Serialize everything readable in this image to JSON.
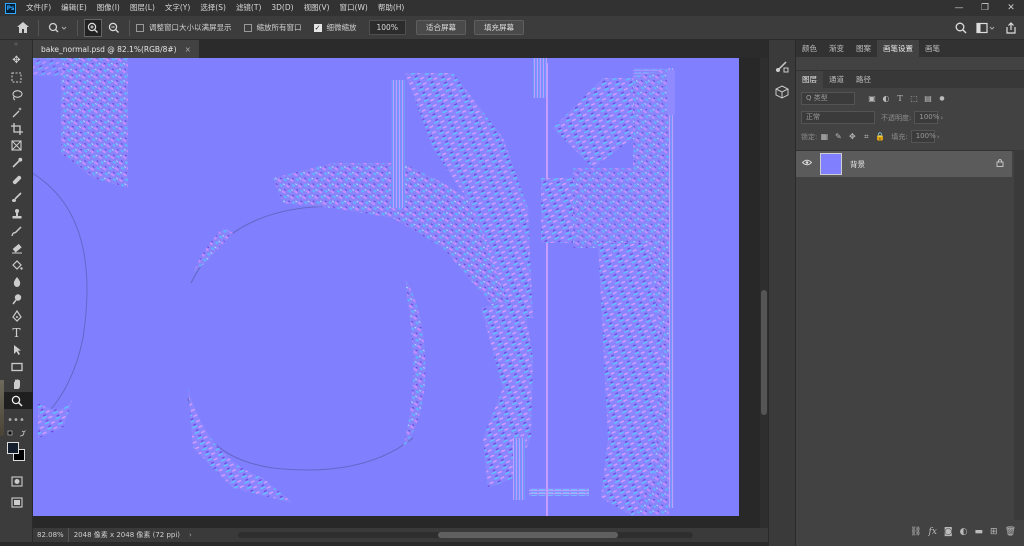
{
  "app": {
    "logo": "Ps"
  },
  "menu": [
    "文件(F)",
    "编辑(E)",
    "图像(I)",
    "图层(L)",
    "文字(Y)",
    "选择(S)",
    "滤镜(T)",
    "3D(D)",
    "视图(V)",
    "窗口(W)",
    "帮助(H)"
  ],
  "window": {
    "minimize": "—",
    "restore": "❐",
    "close": "✕"
  },
  "options": {
    "resize_windows": {
      "label": "调整窗口大小以满屏显示",
      "checked": false
    },
    "zoom_all": {
      "label": "缩放所有窗口",
      "checked": false
    },
    "scrubby_zoom": {
      "label": "细微缩放",
      "checked": true
    },
    "zoom_value": "100%",
    "fit_screen": "适合屏幕",
    "fill_screen": "填充屏幕"
  },
  "document": {
    "tab_title": "bake_normal.psd @ 82.1%(RGB/8#)",
    "close": "×"
  },
  "status": {
    "zoom": "82.08%",
    "info": "2048 像素 x 2048 像素 (72 ppi)",
    "arrow": "›"
  },
  "panels": {
    "top_tabs": [
      "颜色",
      "渐变",
      "图案",
      "画笔设置",
      "画笔"
    ],
    "top_active": 3,
    "layer_tabs": [
      "图层",
      "通道",
      "路径"
    ],
    "layer_active": 0,
    "filter_placeholder": "Q 类型",
    "blend_mode": "正常",
    "opacity_label": "不透明度:",
    "opacity_value": "100%",
    "lock_label": "锁定:",
    "fill_label": "填充:",
    "fill_value": "100%",
    "layer": {
      "name": "背景"
    }
  },
  "colors": {
    "normal_map_base": "#8080fe",
    "ui_dark": "#323232",
    "ui_panel": "#424242"
  }
}
